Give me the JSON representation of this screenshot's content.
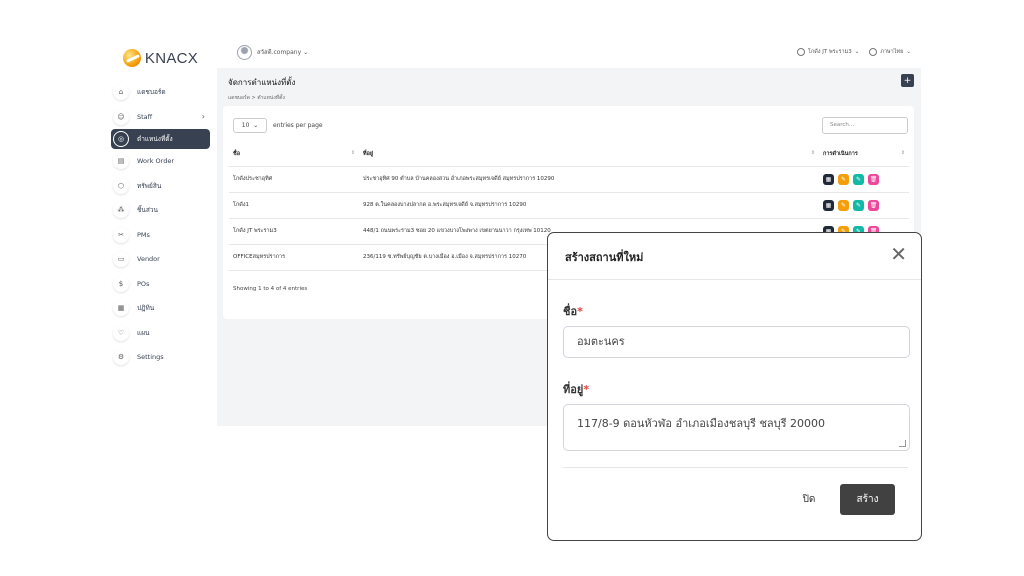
{
  "brand": {
    "logo_text": "KNACX"
  },
  "sidebar": {
    "items": [
      {
        "label": "แดชบอร์ด",
        "icon": "home-icon",
        "glyph": "⌂"
      },
      {
        "label": "Staff",
        "icon": "users-icon",
        "glyph": "☺",
        "chevron": "›"
      },
      {
        "label": "ตำแหน่งที่ตั้ง",
        "icon": "location-icon",
        "glyph": "◎",
        "active": true
      },
      {
        "label": "Work Order",
        "icon": "clipboard-icon",
        "glyph": "▤"
      },
      {
        "label": "ทรัพย์สิน",
        "icon": "asset-icon",
        "glyph": "⬡"
      },
      {
        "label": "ชิ้นส่วน",
        "icon": "parts-icon",
        "glyph": "⁂"
      },
      {
        "label": "PMs",
        "icon": "tools-icon",
        "glyph": "✂"
      },
      {
        "label": "Vendor",
        "icon": "vendor-icon",
        "glyph": "▭"
      },
      {
        "label": "POs",
        "icon": "dollar-icon",
        "glyph": "$"
      },
      {
        "label": "ปฏิทิน",
        "icon": "calendar-icon",
        "glyph": "▦"
      },
      {
        "label": "แผน",
        "icon": "plan-icon",
        "glyph": "♡"
      },
      {
        "label": "Settings",
        "icon": "gear-icon",
        "glyph": "⚙"
      }
    ]
  },
  "topbar": {
    "company": "สวัสดี.company",
    "branch": "โกดัง JT พระราม3",
    "language": "ภาษาไทย",
    "chevron": "⌄"
  },
  "page": {
    "title": "จัดการตำแหน่งที่ตั้ง",
    "breadcrumb": "แดชบอร์ด  >  ตำแหน่งที่ตั้ง",
    "add_button": "+"
  },
  "table": {
    "entries_value": "10",
    "entries_chevron": "⌄",
    "entries_label": "entries per page",
    "search_placeholder": "Search...",
    "headers": [
      "ชื่อ",
      "ที่อยู่",
      "การดำเนินการ"
    ],
    "sort_glyph": "⇕",
    "rows": [
      {
        "name": "โกดังประชาอุทิศ",
        "address": "ประชาอุทิศ 90 ตำบล บ้านคลองสวน อำเภอพระสมุทรเจดีย์ สมุทรปราการ 10290"
      },
      {
        "name": "โกดัง1",
        "address": "928 ต.ในคลองบางปลากด อ.พระสมุทรเจดีย์ จ.สมุทรปราการ 10290"
      },
      {
        "name": "โกดัง JT พระราม3",
        "address": "448/1 ถนนพระราม3 ซอย 20 แขวงบางโพงพาง เขตยานนาวา กรุงเทพ 10120"
      },
      {
        "name": "OFFICEสมุทรปราการ",
        "address": "236/119 ซ.ทรัพย์บุญชัย ต.บางเมือง อ.เมือง จ.สมุทรปราการ 10270"
      }
    ],
    "action_glyphs": [
      "▦",
      "✎",
      "✎",
      "🗑"
    ],
    "action_colors": [
      "#1f2937",
      "#f59e0b",
      "#14b8a6",
      "#ec4899"
    ],
    "showing": "Showing 1 to 4 of 4 entries"
  },
  "modal": {
    "title": "สร้างสถานที่ใหม่",
    "close_glyph": "✕",
    "name_label": "ชื่อ",
    "name_value": "อมตะนคร",
    "address_label": "ที่อยู่",
    "address_value": "117/8-9 ดอนหัวฬ่อ อำเภอเมืองชลบุรี ชลบุรี 20000",
    "required_mark": "*",
    "close_button": "ปิด",
    "create_button": "สร้าง"
  }
}
